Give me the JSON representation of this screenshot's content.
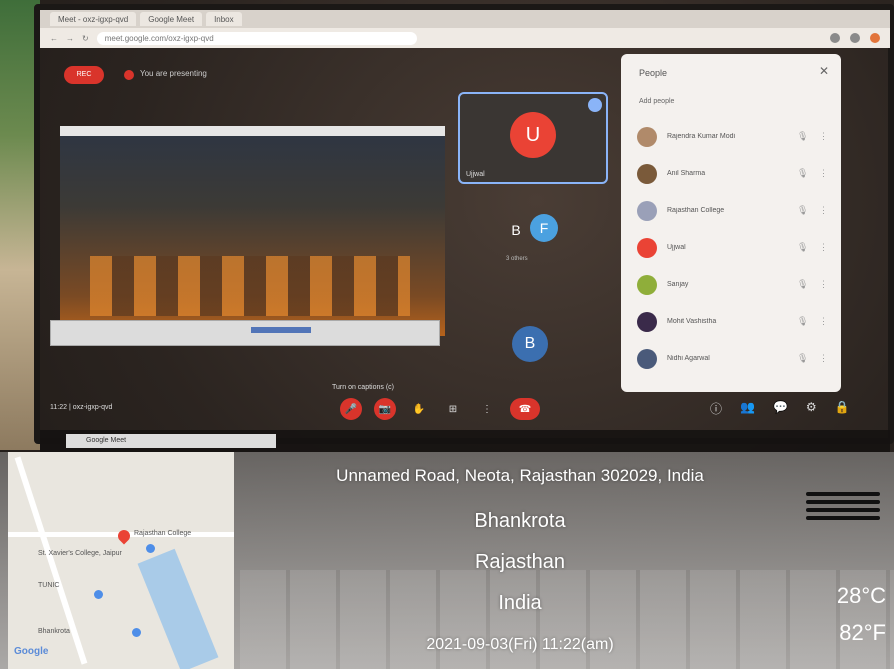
{
  "browser": {
    "tabs": [
      "Meet - oxz-igxp-qvd",
      "Google Meet",
      "Inbox"
    ],
    "url": "meet.google.com/oxz-igxp-qvd"
  },
  "meet": {
    "rec_label": "REC",
    "presenting_label": "You are presenting",
    "tile_avatar": "U",
    "tile_name": "Ujjwal",
    "avatar_b": "B",
    "avatar_f": "F",
    "avatar_b2": "B",
    "small_caption": "3 others",
    "turn_caption": "Turn on captions (c)",
    "time_caption": "11:22 | oxz-igxp-qvd"
  },
  "people_panel": {
    "title": "People",
    "close": "✕",
    "add_label": "Add people",
    "participants": [
      {
        "name": "Rajendra Kumar Modi",
        "color": "#b08a6a"
      },
      {
        "name": "Anil Sharma",
        "color": "#7a5a3a"
      },
      {
        "name": "Rajasthan College",
        "color": "#9aa0b8"
      },
      {
        "name": "Ujjwal",
        "color": "#ea4335"
      },
      {
        "name": "Sanjay",
        "color": "#8fae3a"
      },
      {
        "name": "Mohit Vashistha",
        "color": "#3a2a4a"
      },
      {
        "name": "Nidhi Agarwal",
        "color": "#4a5a7a"
      }
    ]
  },
  "controls": {
    "mic": "🎤",
    "cam": "📷",
    "hand": "✋",
    "present": "⊞",
    "more": "⋮",
    "hangup": "☎",
    "info": "ⓘ",
    "people": "👥",
    "chat": "💬",
    "activities": "⚙",
    "lock": "🔒"
  },
  "taskbar": {
    "window_label": "Google Meet"
  },
  "gps": {
    "address": "Unnamed Road, Neota, Rajasthan 302029, India",
    "locality": "Bhankrota",
    "state": "Rajasthan",
    "country": "India",
    "datetime": "2021-09-03(Fri)  11:22(am)",
    "temp_c": "28°C",
    "temp_f": "82°F",
    "weather_icon": "haze-icon"
  },
  "map": {
    "labels": [
      "Rajasthan College",
      "St. Xavier's College, Jaipur",
      "TUNIC",
      "Bhankrota",
      "Google"
    ]
  }
}
